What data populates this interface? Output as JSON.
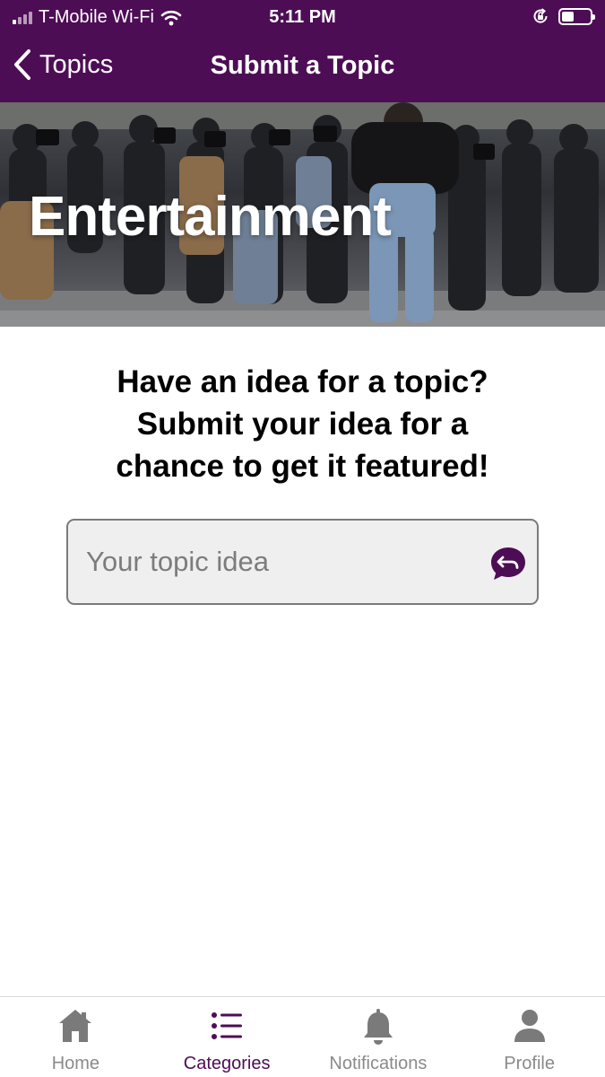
{
  "status_bar": {
    "carrier": "T-Mobile Wi-Fi",
    "time": "5:11 PM"
  },
  "header": {
    "back_label": "Topics",
    "title": "Submit a Topic"
  },
  "hero": {
    "title": "Entertainment"
  },
  "prompt": {
    "line1": "Have an idea for a topic?",
    "line2": "Submit your idea for a",
    "line3": "chance to get it featured!"
  },
  "topic_input": {
    "value": "",
    "placeholder": "Your topic idea"
  },
  "tabs": [
    {
      "label": "Home",
      "icon": "home-icon",
      "active": false
    },
    {
      "label": "Categories",
      "icon": "list-icon",
      "active": true
    },
    {
      "label": "Notifications",
      "icon": "bell-icon",
      "active": false
    },
    {
      "label": "Profile",
      "icon": "person-icon",
      "active": false
    }
  ],
  "colors": {
    "brand": "#4d0d55",
    "inactive_tab": "#8a8a8a",
    "field_bg": "#efefef"
  }
}
